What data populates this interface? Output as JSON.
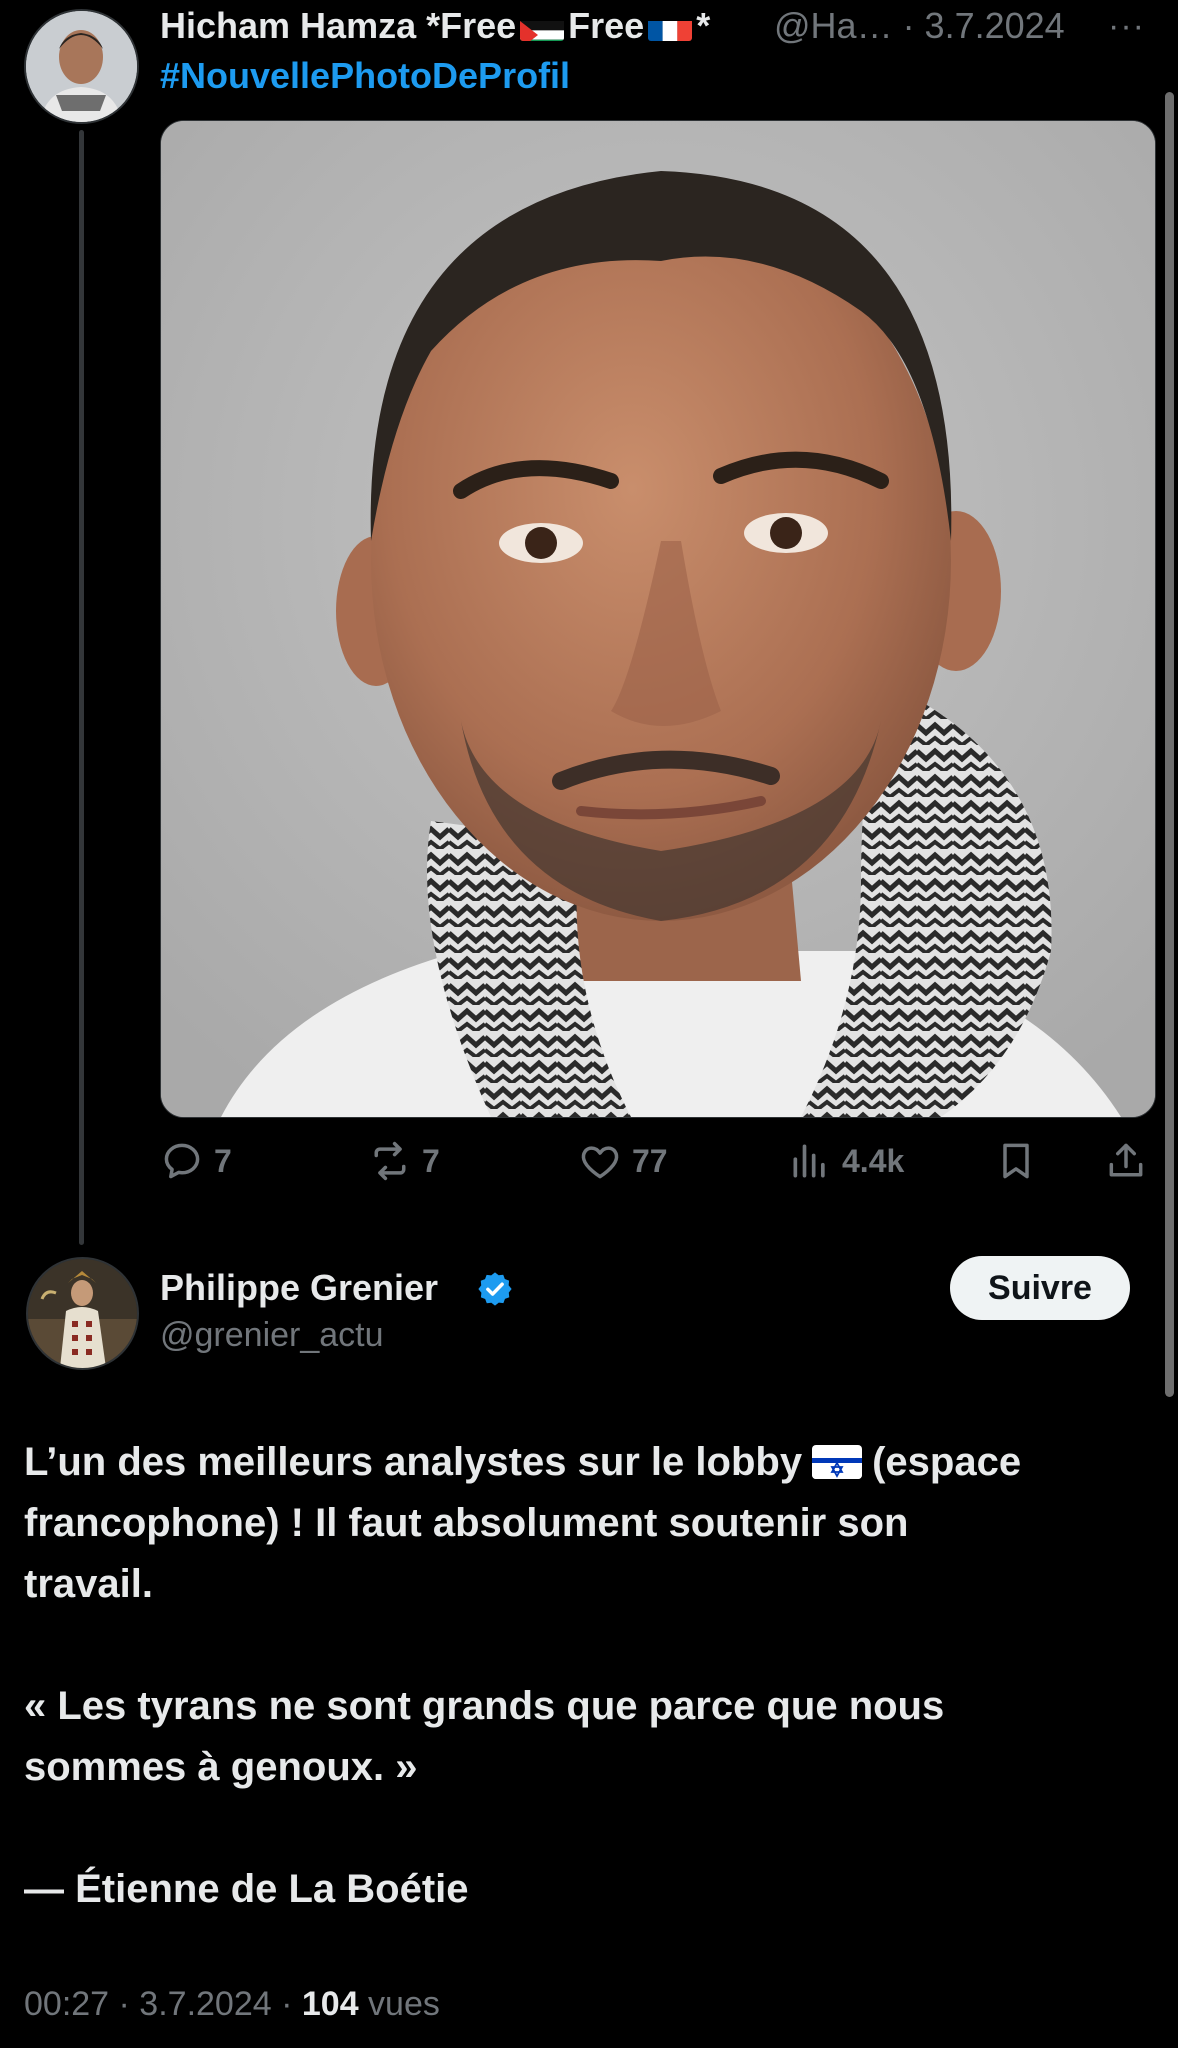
{
  "thread": {
    "post1": {
      "author_name": "Hicham Hamza *Free",
      "author_free_mid": "Free",
      "author_suffix": "*",
      "handle_date": "@Ha… · 3.7.2024",
      "hashtag": "#NouvellePhotoDeProfil",
      "more_icon": "more-dots-icon",
      "actions": {
        "replies": "7",
        "reposts": "7",
        "likes": "77",
        "views": "4.4k"
      }
    },
    "post2": {
      "author_name": "Philippe Grenier",
      "handle": "@grenier_actu",
      "follow_label": "Suivre",
      "body_line1_a": "L’un des meilleurs analystes sur le lobby",
      "body_line1_b": "(espace",
      "body_line2": "francophone) ! Il faut absolument soutenir son",
      "body_line3": "travail.",
      "quote_line1": "« Les tyrans ne sont grands que parce que nous",
      "quote_line2": "sommes à genoux. »",
      "attribution": "— Étienne de La Boétie",
      "time_date": "00:27 · 3.7.2024 · ",
      "views_count": "104",
      "views_label": " vues"
    }
  },
  "colors": {
    "background": "#000000",
    "text": "#e7e9ea",
    "muted": "#71767b",
    "link": "#1d9bf0",
    "verified": "#1d9bf0"
  }
}
